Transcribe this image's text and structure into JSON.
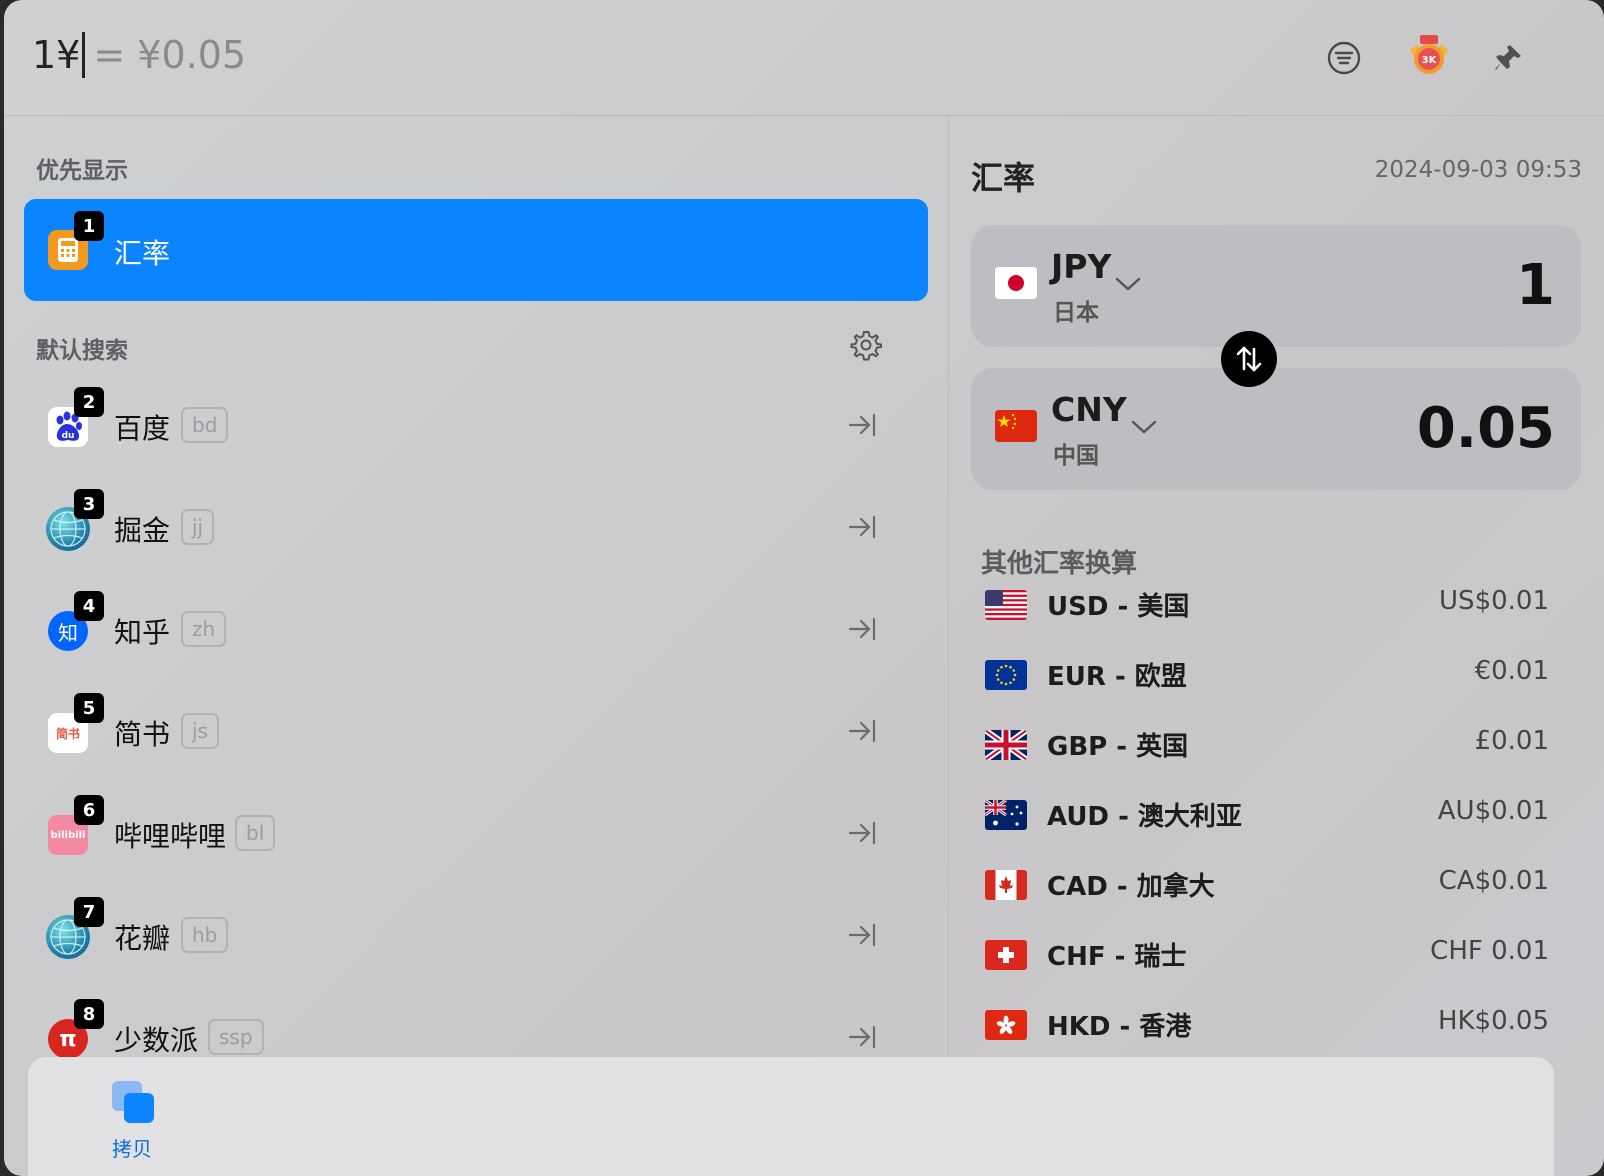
{
  "search": {
    "query": "1¥",
    "result": "= ¥0.05"
  },
  "left": {
    "priority_title": "优先显示",
    "selected": {
      "index": "1",
      "label": "汇率"
    },
    "default_title": "默认搜索",
    "engines": [
      {
        "index": "2",
        "label": "百度",
        "keyword": "bd",
        "icon": "baidu-icon"
      },
      {
        "index": "3",
        "label": "掘金",
        "keyword": "jj",
        "icon": "globe-icon"
      },
      {
        "index": "4",
        "label": "知乎",
        "keyword": "zh",
        "icon": "zhihu-icon"
      },
      {
        "index": "5",
        "label": "简书",
        "keyword": "js",
        "icon": "jianshu-icon"
      },
      {
        "index": "6",
        "label": "哔哩哔哩",
        "keyword": "bl",
        "icon": "bilibili-icon"
      },
      {
        "index": "7",
        "label": "花瓣",
        "keyword": "hb",
        "icon": "globe-icon"
      },
      {
        "index": "8",
        "label": "少数派",
        "keyword": "ssp",
        "icon": "sspai-icon"
      }
    ],
    "icon_text": {
      "zhihu": "知",
      "jianshu": "简书",
      "baidu": "du",
      "bilibili": "bilibili",
      "sspai": "π"
    }
  },
  "right": {
    "title": "汇率",
    "timestamp": "2024-09-03 09:53",
    "from": {
      "code": "JPY",
      "country": "日本",
      "value": "1"
    },
    "to": {
      "code": "CNY",
      "country": "中国",
      "value": "0.05"
    },
    "other_title": "其他汇率换算",
    "rates": [
      {
        "label": "USD - 美国",
        "value": "US$0.01",
        "flag": "us"
      },
      {
        "label": "EUR - 欧盟",
        "value": "€0.01",
        "flag": "eu"
      },
      {
        "label": "GBP - 英国",
        "value": "£0.01",
        "flag": "gb"
      },
      {
        "label": "AUD - 澳大利亚",
        "value": "AU$0.01",
        "flag": "au"
      },
      {
        "label": "CAD - 加拿大",
        "value": "CA$0.01",
        "flag": "ca"
      },
      {
        "label": "CHF - 瑞士",
        "value": "CHF 0.01",
        "flag": "ch"
      },
      {
        "label": "HKD - 香港",
        "value": "HK$0.05",
        "flag": "hk"
      }
    ]
  },
  "bottom": {
    "copy_label": "拷贝"
  },
  "badge": {
    "text": "3K"
  },
  "colors": {
    "accent": "#0a84ff",
    "background": "#cbcbcd"
  }
}
